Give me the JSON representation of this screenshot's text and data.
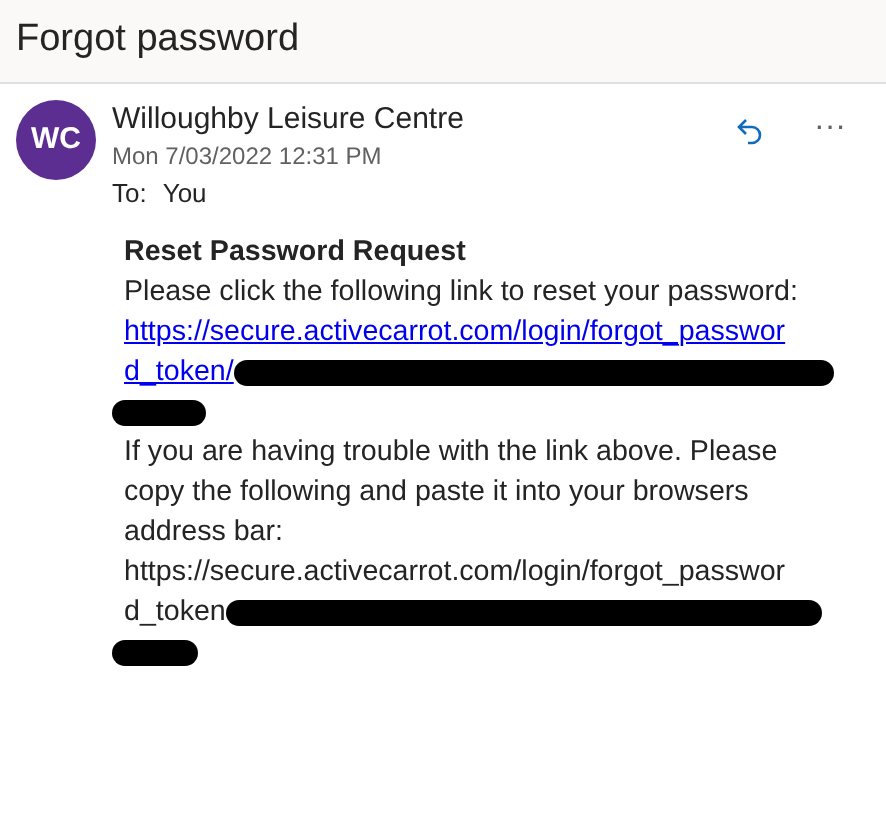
{
  "header": {
    "title": "Forgot password"
  },
  "message": {
    "avatar": "WC",
    "sender": "Willoughby Leisure Centre",
    "date": "Mon 7/03/2022 12:31 PM",
    "to_label": "To:",
    "to": "You",
    "actions": [
      {
        "kind": "reply"
      },
      {
        "kind": "more",
        "label": "···"
      }
    ],
    "body": [
      {
        "kind": "heading",
        "text": "Reset Password Request"
      },
      {
        "kind": "paragraph",
        "text": "Please click the following link to reset your password:"
      },
      {
        "kind": "link",
        "lines": [
          "https://secure.activecarrot.com/login/forgot_passwor",
          "d_token/"
        ],
        "redacted": true
      },
      {
        "kind": "paragraph",
        "text": "If you are having trouble with the link above. Please copy the following and paste it into your browsers address bar:"
      },
      {
        "kind": "plain_url",
        "lines": [
          "https://secure.activecarrot.com/login/forgot_passwor",
          "d_token"
        ],
        "redacted": true
      }
    ]
  }
}
